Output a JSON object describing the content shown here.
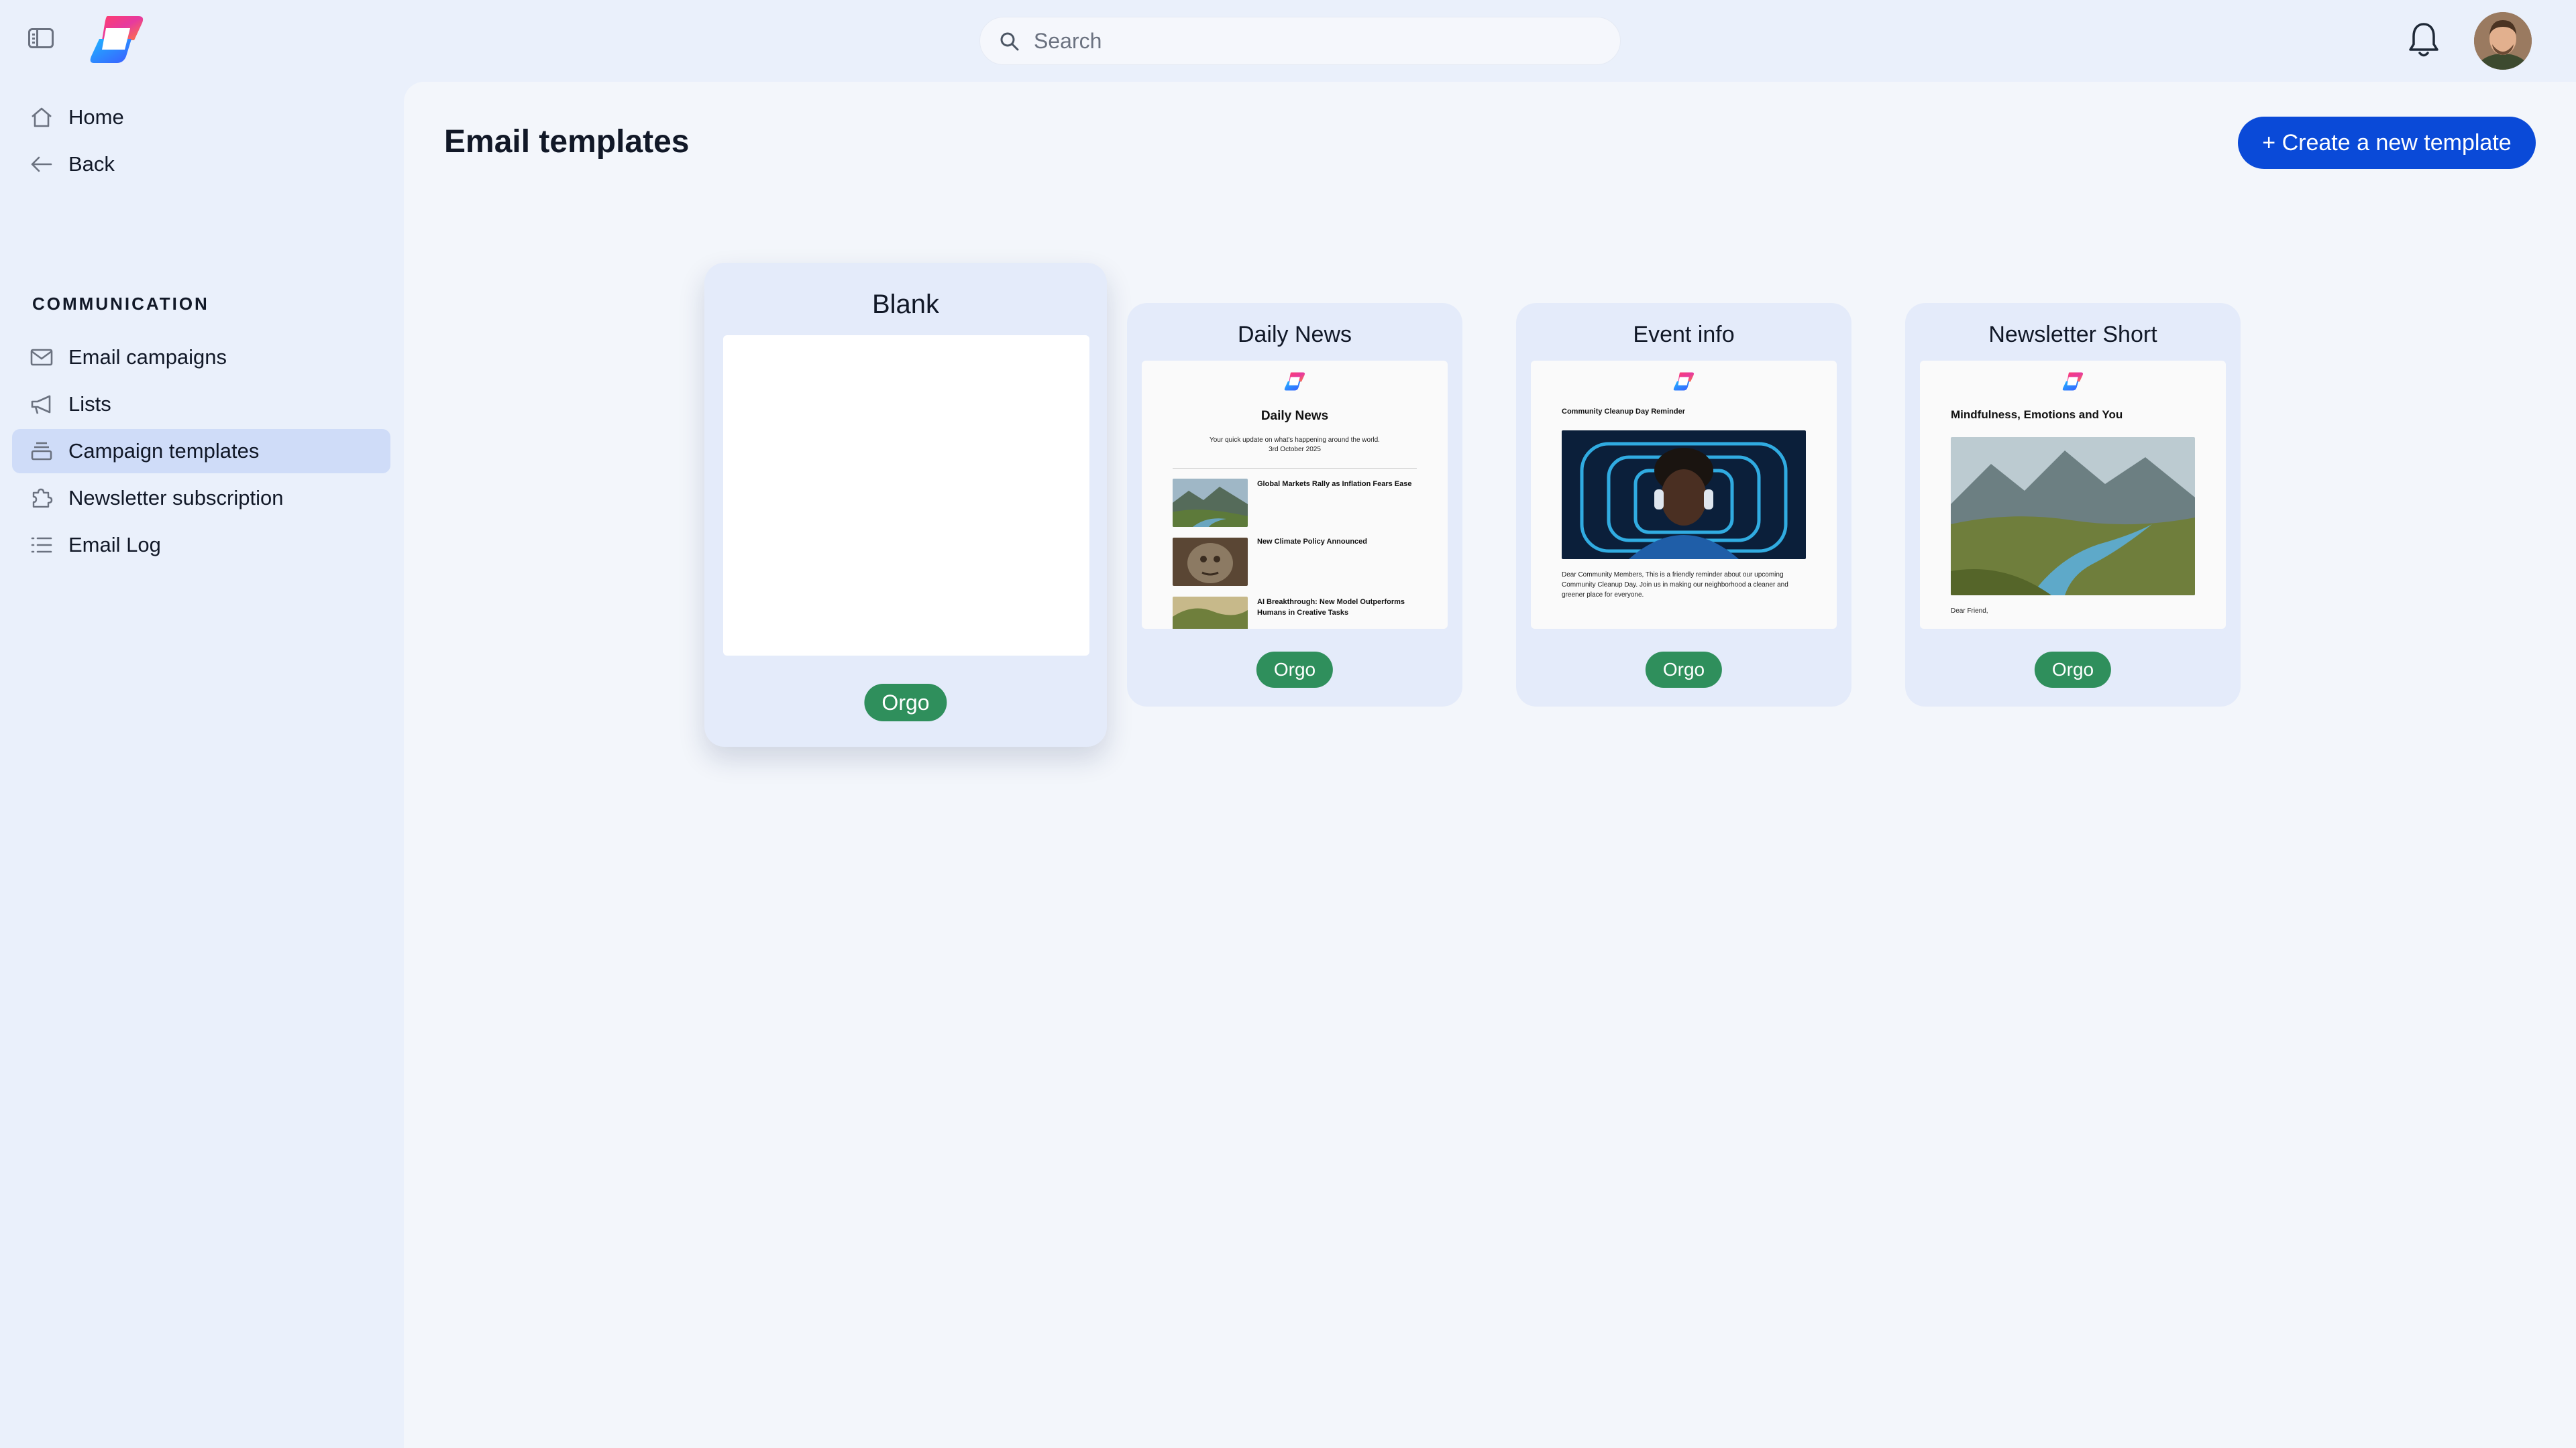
{
  "app": {
    "brand_colors": {
      "accent": "#0a4ad8",
      "badge": "#2f8f5c",
      "active_nav": "#cfdcf8"
    }
  },
  "header": {
    "search_placeholder": "Search",
    "icons": [
      "sidebar-toggle-icon",
      "logo",
      "search-icon",
      "bell-icon",
      "avatar"
    ]
  },
  "sidebar": {
    "top_items": [
      {
        "label": "Home",
        "icon": "home-icon"
      },
      {
        "label": "Back",
        "icon": "arrow-left-icon"
      }
    ],
    "section_title": "COMMUNICATION",
    "items": [
      {
        "label": "Email campaigns",
        "icon": "mail-icon",
        "active": false
      },
      {
        "label": "Lists",
        "icon": "megaphone-icon",
        "active": false
      },
      {
        "label": "Campaign templates",
        "icon": "stack-icon",
        "active": true
      },
      {
        "label": "Newsletter subscription",
        "icon": "puzzle-icon",
        "active": false
      },
      {
        "label": "Email Log",
        "icon": "list-icon",
        "active": false
      }
    ]
  },
  "main": {
    "title": "Email templates",
    "create_button": "+ Create a new template",
    "templates": [
      {
        "name": "Blank",
        "badge": "Orgo"
      },
      {
        "name": "Daily News",
        "badge": "Orgo",
        "preview": {
          "title": "Daily News",
          "subtitle": "Your quick update on what's happening around the world.",
          "date": "3rd October 2025",
          "items": [
            "Global Markets Rally as Inflation Fears Ease",
            "New Climate Policy Announced",
            "AI Breakthrough: New Model Outperforms Humans in Creative Tasks"
          ]
        }
      },
      {
        "name": "Event info",
        "badge": "Orgo",
        "preview": {
          "title": "Community Cleanup Day Reminder",
          "body": "Dear Community Members, This is a friendly reminder about our upcoming Community Cleanup Day. Join us in making our neighborhood a cleaner and greener place for everyone."
        }
      },
      {
        "name": "Newsletter Short",
        "badge": "Orgo",
        "preview": {
          "title": "Mindfulness, Emotions and You",
          "greeting": "Dear Friend,"
        }
      }
    ]
  }
}
